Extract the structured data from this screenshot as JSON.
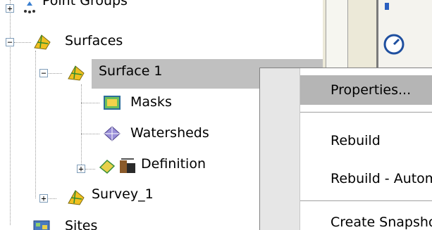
{
  "tree": {
    "point_groups_label": "Point Groups",
    "surfaces_label": "Surfaces",
    "surface1_label": "Surface 1",
    "masks_label": "Masks",
    "watersheds_label": "Watersheds",
    "definition_label": "Definition",
    "survey1_label": "Survey_1",
    "sites_label": "Sites",
    "expand_glyph": "+",
    "collapse_glyph": "−"
  },
  "context_menu": {
    "items": [
      {
        "label": "Properties..."
      },
      {
        "label": "Rebuild"
      },
      {
        "label": "Rebuild - Automatic"
      },
      {
        "label": "Create Snapshot"
      }
    ]
  },
  "icons": {
    "point_groups": "point-groups-icon",
    "surface": "surface-icon",
    "masks": "masks-icon",
    "watersheds": "watersheds-icon",
    "definition": "definition-icon",
    "sites": "sites-icon",
    "gauge": "gauge-icon"
  },
  "colors": {
    "selection": "#c0c0c0",
    "menu_highlight": "#b5b5b5",
    "surface_icon": "#f0c020"
  }
}
